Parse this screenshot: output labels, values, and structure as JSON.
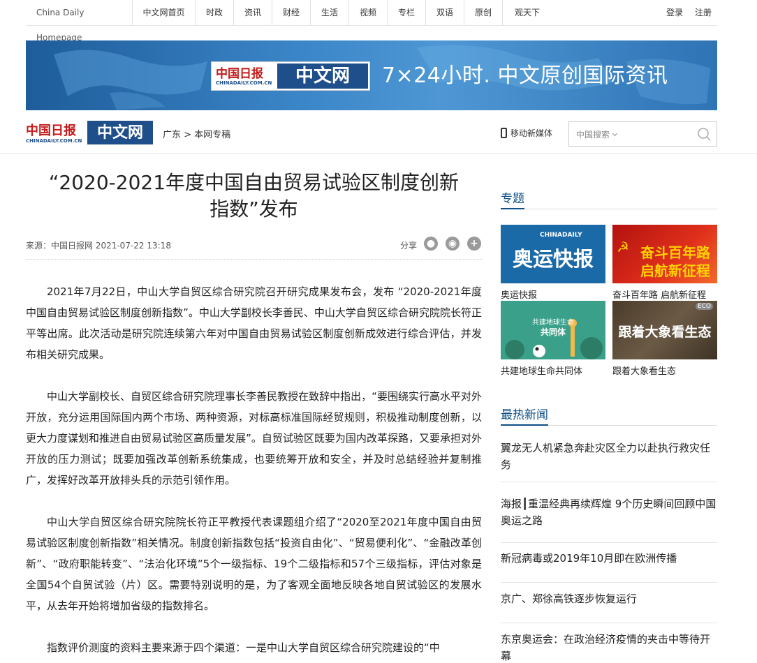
{
  "topnav": {
    "home": "China Daily Homepage",
    "items": [
      "中文网首页",
      "时政",
      "资讯",
      "财经",
      "生活",
      "视频",
      "专栏",
      "双语",
      "原创",
      "观天下"
    ],
    "login": "登录",
    "register": "注册"
  },
  "banner": {
    "logo_cn": "中国日报",
    "logo_site": "中文网",
    "logo_url": "CHINADAILY.COM.CN",
    "slogan": "7×24小时. 中文原创国际资讯"
  },
  "header": {
    "logo_cn": "中国日报",
    "logo_site": "中文网",
    "logo_url": "CHINADAILY.COM.CN",
    "breadcrumb": "广东 > 本网专稿",
    "mobile_label": "移动新媒体",
    "search_scope": "中国搜索"
  },
  "article": {
    "title_line1": "“2020-2021年度中国自由贸易试验区制度创新",
    "title_line2": "指数”发布",
    "source": "来源：中国日报网 2021-07-22 13:18",
    "share_label": "分享",
    "paragraphs": [
      "2021年7月22日，中山大学自贸区综合研究院召开研究成果发布会，发布 “2020-2021年度中国自由贸易试验区制度创新指数”。中山大学副校长李善民、中山大学自贸区综合研究院院长符正平等出席。此次活动是研究院连续第六年对中国自由贸易试验区制度创新成效进行综合评估，并发布相关研究成果。",
      "中山大学副校长、自贸区综合研究院理事长李善民教授在致辞中指出，“要围绕实行高水平对外开放，充分运用国际国内两个市场、两种资源，对标高标准国际经贸规则，积极推动制度创新，以更大力度谋划和推进自由贸易试验区高质量发展”。自贸试验区既要为国内改革探路，又要承担对外开放的压力测试；既要加强改革创新系统集成，也要统筹开放和安全，并及时总结经验并复制推广，发挥好改革开放排头兵的示范引领作用。",
      "中山大学自贸区综合研究院院长符正平教授代表课题组介绍了“2020至2021年度中国自由贸易试验区制度创新指数”相关情况。制度创新指数包括“投资自由化”、“贸易便利化”、“金融改革创新”、“政府职能转变”、“法治化环境”5个一级指标、19个二级指标和57个三级指标，评估对象是全国54个自贸试验（片）区。需要特别说明的是，为了客观全面地反映各地自贸试验区的发展水平，从去年开始将增加省级的指数排名。",
      "指数评价测度的资料主要来源于四个渠道：一是中山大学自贸区综合研究院建设的“中"
    ]
  },
  "sidebar": {
    "topics_title": "专题",
    "topics": [
      {
        "caption": "奥运快报",
        "img_text": "奥运快报",
        "img_brand": "CHINADAILY"
      },
      {
        "caption": "奋斗百年路 启航新征程",
        "img_text": "奋斗百年路",
        "img_text2": "启航新征程"
      },
      {
        "caption": "共建地球生命共同体",
        "img_text": "共建地球生命",
        "img_text2": "共同体"
      },
      {
        "caption": "跟着大象看生态",
        "img_text": "跟着大象看生态",
        "img_brand": "ECO"
      }
    ],
    "hot_title": "最热新闻",
    "hot_news": [
      "翼龙无人机紧急奔赴灾区全力以赴执行救灾任务",
      "海报┃重温经典再续辉煌 9个历史瞬间回顾中国奥运之路",
      "新冠病毒或2019年10月即在欧洲传播",
      "京广、郑徐高铁逐步恢复运行",
      "东京奥运会：在政治经济疫情的夹击中等待开幕"
    ]
  },
  "colors": {
    "accent": "#0e4f86",
    "banner_blue": "#3b86c8",
    "logo_red": "#c41a1a"
  }
}
